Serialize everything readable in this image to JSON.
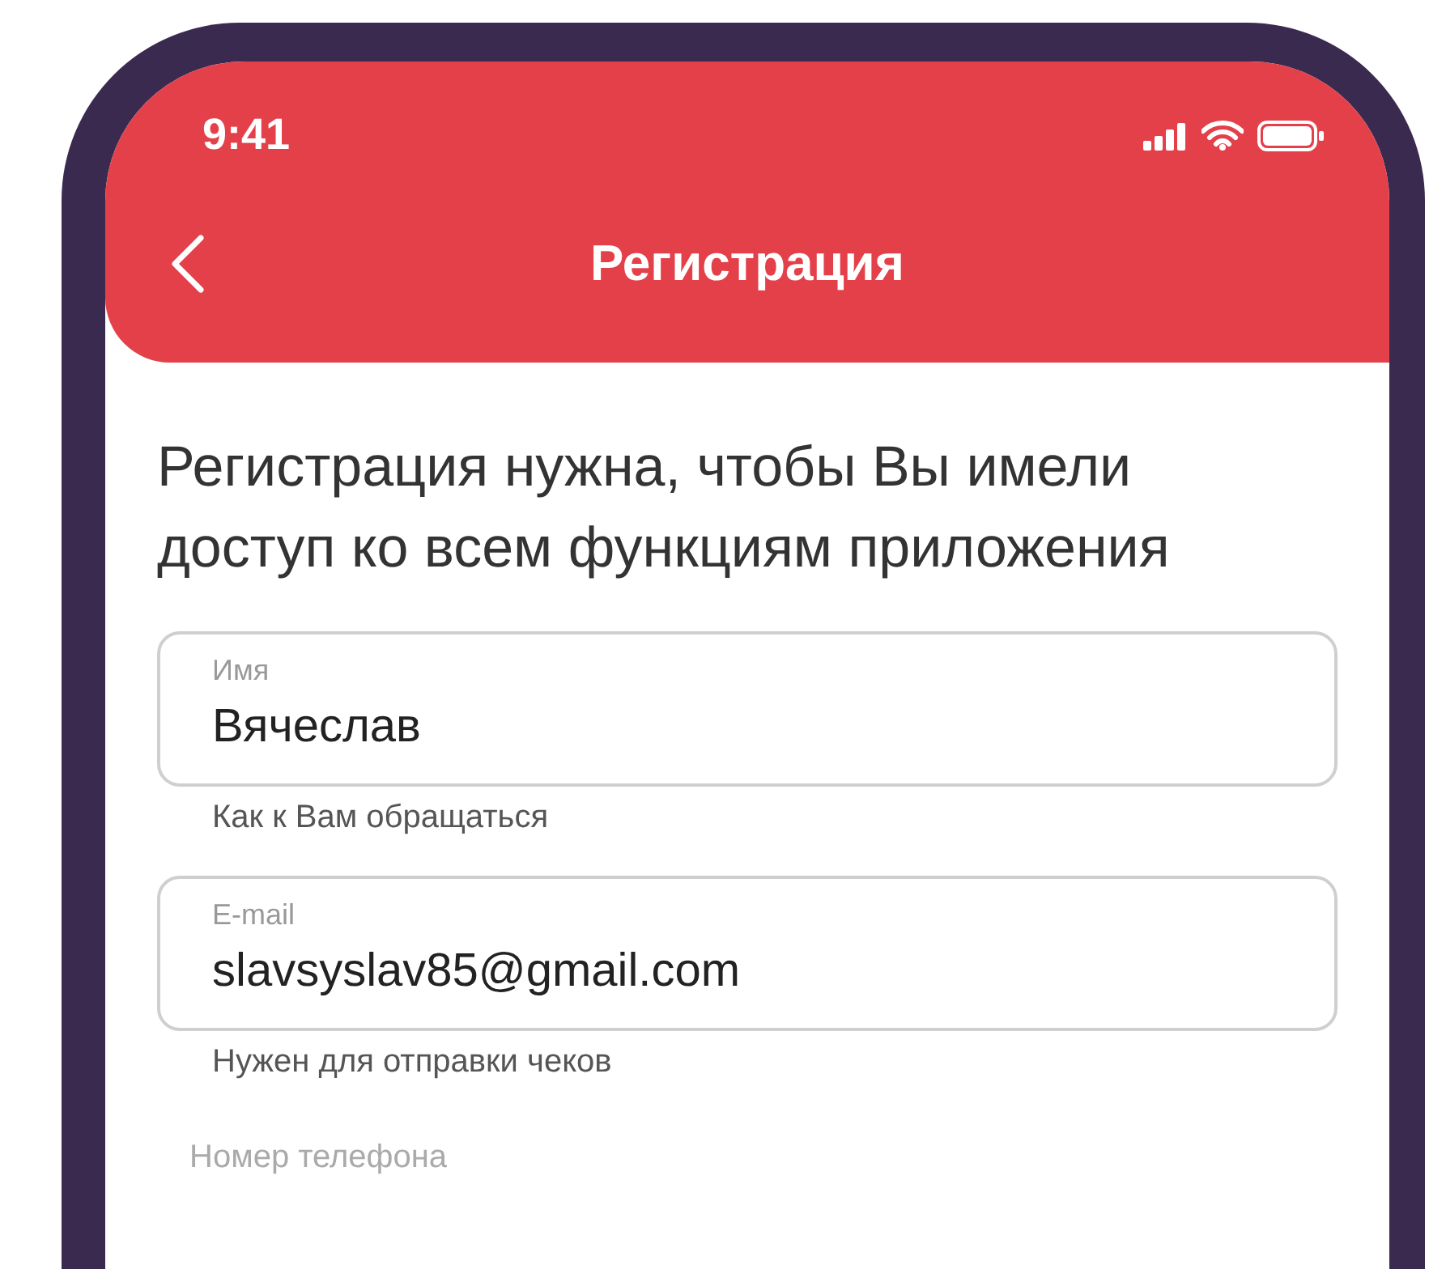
{
  "status_bar": {
    "time": "9:41"
  },
  "header": {
    "title": "Регистрация"
  },
  "intro": "Регистрация нужна, чтобы Вы имели доступ ко всем функциям приложения",
  "fields": [
    {
      "kind": "outlined",
      "label": "Имя",
      "value": "Вячеслав",
      "helper": "Как к Вам обращаться"
    },
    {
      "kind": "outlined",
      "label": "E-mail",
      "value": "slavsyslav85@gmail.com",
      "helper": "Нужен для отправки чеков"
    },
    {
      "kind": "plain",
      "placeholder": "Номер телефона"
    }
  ]
}
